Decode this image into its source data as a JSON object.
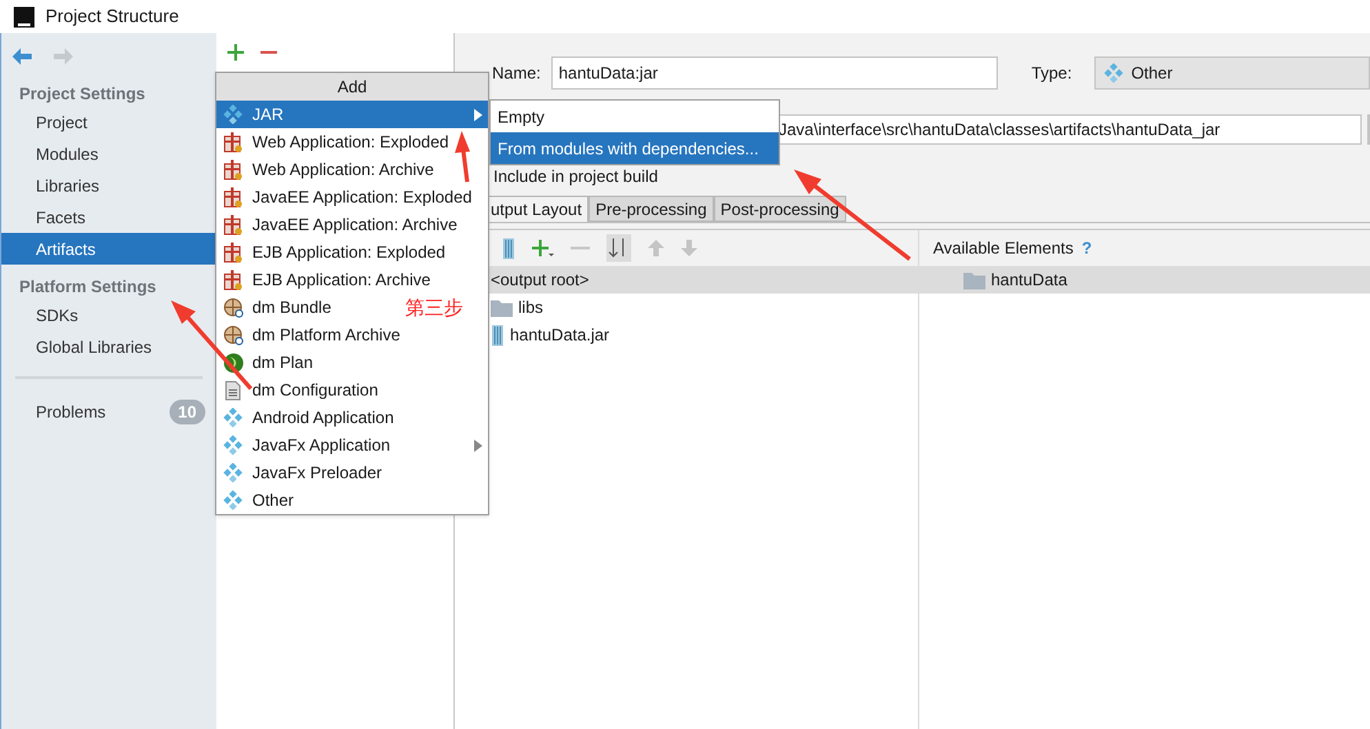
{
  "window": {
    "title": "Project Structure"
  },
  "sidebar": {
    "sections": [
      {
        "title": "Project Settings",
        "items": [
          {
            "label": "Project",
            "selected": false
          },
          {
            "label": "Modules",
            "selected": false
          },
          {
            "label": "Libraries",
            "selected": false
          },
          {
            "label": "Facets",
            "selected": false
          },
          {
            "label": "Artifacts",
            "selected": true
          }
        ]
      },
      {
        "title": "Platform Settings",
        "items": [
          {
            "label": "SDKs",
            "selected": false
          },
          {
            "label": "Global Libraries",
            "selected": false
          }
        ]
      }
    ],
    "problems": {
      "label": "Problems",
      "count": "10"
    }
  },
  "add_menu": {
    "title": "Add",
    "items": [
      {
        "label": "JAR",
        "kind": "diamond",
        "selected": true,
        "submenu": true
      },
      {
        "label": "Web Application: Exploded",
        "kind": "gift",
        "selected": false,
        "submenu": false
      },
      {
        "label": "Web Application: Archive",
        "kind": "gift",
        "selected": false,
        "submenu": false
      },
      {
        "label": "JavaEE Application: Exploded",
        "kind": "gift",
        "selected": false,
        "submenu": false
      },
      {
        "label": "JavaEE Application: Archive",
        "kind": "gift",
        "selected": false,
        "submenu": false
      },
      {
        "label": "EJB Application: Exploded",
        "kind": "gift",
        "selected": false,
        "submenu": false
      },
      {
        "label": "EJB Application: Archive",
        "kind": "gift",
        "selected": false,
        "submenu": false
      },
      {
        "label": "dm Bundle",
        "kind": "bundle",
        "selected": false,
        "submenu": false
      },
      {
        "label": "dm Platform Archive",
        "kind": "bundle",
        "selected": false,
        "submenu": false
      },
      {
        "label": "dm Plan",
        "kind": "sphere",
        "selected": false,
        "submenu": false
      },
      {
        "label": "dm Configuration",
        "kind": "document",
        "selected": false,
        "submenu": false
      },
      {
        "label": "Android Application",
        "kind": "diamond",
        "selected": false,
        "submenu": false
      },
      {
        "label": "JavaFx Application",
        "kind": "diamond",
        "selected": false,
        "submenu": true
      },
      {
        "label": "JavaFx Preloader",
        "kind": "diamond",
        "selected": false,
        "submenu": false
      },
      {
        "label": "Other",
        "kind": "diamond",
        "selected": false,
        "submenu": false
      }
    ]
  },
  "jar_submenu": {
    "items": [
      {
        "label": "Empty",
        "selected": false
      },
      {
        "label": "From modules with dependencies...",
        "selected": true
      }
    ]
  },
  "annotation": {
    "text": "第三步"
  },
  "artifact": {
    "name_label": "Name:",
    "name": "hantuData:jar",
    "type_label": "Type:",
    "type": "Other",
    "output_directory": "Java\\interface\\src\\hantuData\\classes\\artifacts\\hantuData_jar",
    "include_in_build": "Include in project build"
  },
  "tabs": [
    {
      "label": "utput Layout",
      "selected": true
    },
    {
      "label": "Pre-processing",
      "selected": false
    },
    {
      "label": "Post-processing",
      "selected": false
    }
  ],
  "layout_tree": [
    {
      "label": "<output root>",
      "kind": "root",
      "selected": true
    },
    {
      "label": "libs",
      "kind": "folder",
      "selected": false
    },
    {
      "label": "hantuData.jar",
      "kind": "jar",
      "selected": false
    }
  ],
  "available": {
    "title": "Available Elements",
    "help": "?",
    "items": [
      {
        "label": "hantuData",
        "selected": true
      }
    ]
  }
}
